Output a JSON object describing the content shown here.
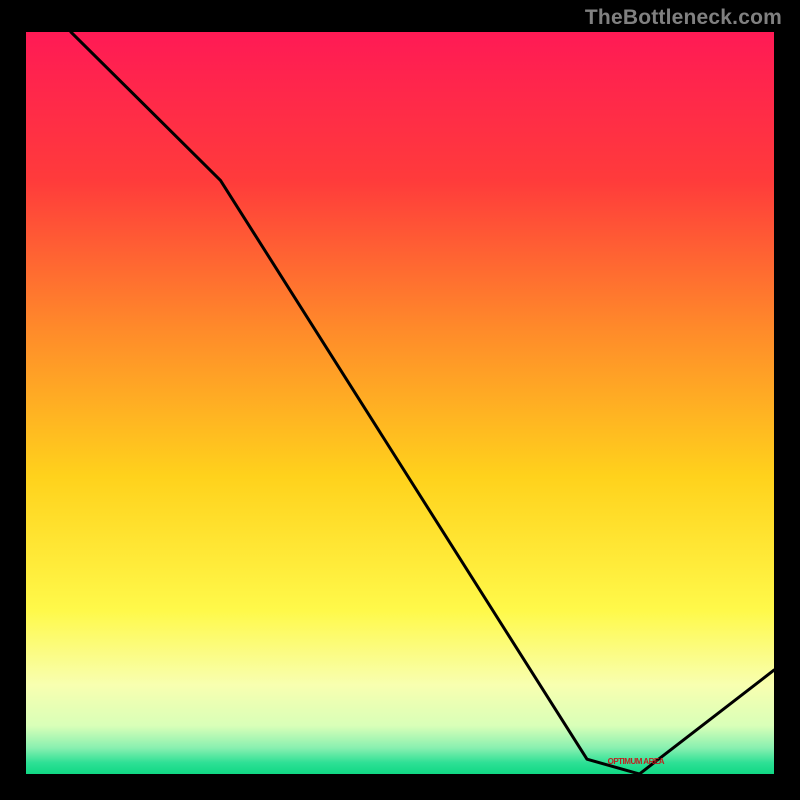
{
  "watermark": "TheBottleneck.com",
  "marker_label": "OPTIMUM AREA",
  "chart_data": {
    "type": "line",
    "title": "",
    "xlabel": "",
    "ylabel": "",
    "xlim": [
      0,
      100
    ],
    "ylim": [
      0,
      100
    ],
    "series": [
      {
        "name": "curve",
        "x": [
          6,
          26,
          75,
          82,
          100
        ],
        "y": [
          100,
          80,
          2,
          0,
          14
        ]
      }
    ],
    "optimum_x_range": [
      75,
      88
    ],
    "background": {
      "type": "vertical-gradient",
      "stops": [
        {
          "pos": 0.0,
          "color": "#ff1a55"
        },
        {
          "pos": 0.2,
          "color": "#ff3b3b"
        },
        {
          "pos": 0.4,
          "color": "#ff8a2a"
        },
        {
          "pos": 0.6,
          "color": "#ffd21c"
        },
        {
          "pos": 0.78,
          "color": "#fff94a"
        },
        {
          "pos": 0.88,
          "color": "#f8ffb0"
        },
        {
          "pos": 0.935,
          "color": "#d9ffb8"
        },
        {
          "pos": 0.965,
          "color": "#88f0b0"
        },
        {
          "pos": 0.985,
          "color": "#2de095"
        },
        {
          "pos": 1.0,
          "color": "#10d884"
        }
      ]
    }
  }
}
